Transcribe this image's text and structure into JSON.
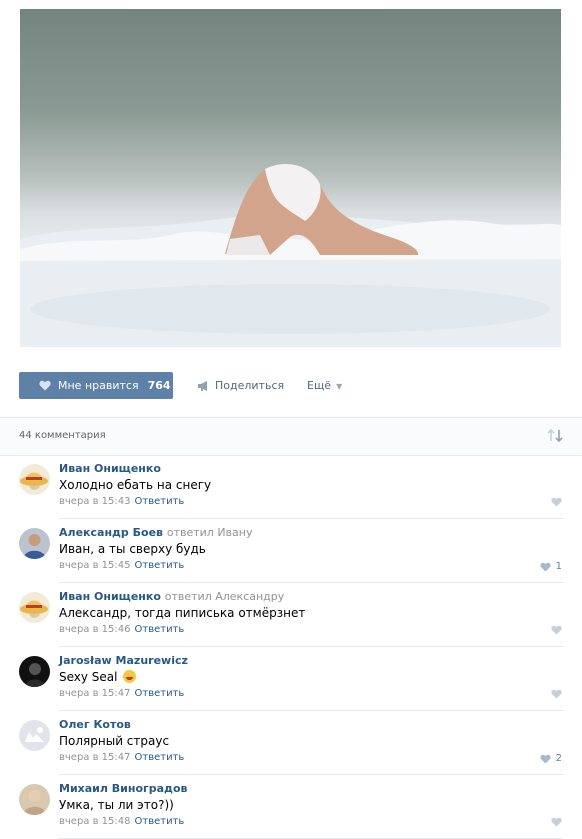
{
  "post": {
    "like_label": "Мне нравится",
    "like_count": "764",
    "share_label": "Поделиться",
    "more_label": "Ещё"
  },
  "comments_header": {
    "count_label": "44 комментария"
  },
  "comments": [
    {
      "author": "Иван Онищенко",
      "replied": "",
      "text": "Холодно ебать на снегу",
      "time": "вчера в 15:43",
      "reply_label": "Ответить",
      "likes": ""
    },
    {
      "author": "Александр Боев",
      "replied": "ответил Ивану",
      "text": "Иван, а ты сверху будь",
      "time": "вчера в 15:45",
      "reply_label": "Ответить",
      "likes": "1"
    },
    {
      "author": "Иван Онищенко",
      "replied": "ответил Александру",
      "text": "Александр, тогда пиписька отмёрзнет",
      "time": "вчера в 15:46",
      "reply_label": "Ответить",
      "likes": ""
    },
    {
      "author": "Jarosław Mazurewicz",
      "replied": "",
      "text": "Sexy Seal",
      "time": "вчера в 15:47",
      "reply_label": "Ответить",
      "likes": ""
    },
    {
      "author": "Олег Котов",
      "replied": "",
      "text": "Полярный страус",
      "time": "вчера в 15:47",
      "reply_label": "Ответить",
      "likes": "2"
    },
    {
      "author": "Михаил Виноградов",
      "replied": "",
      "text": "Умка, ты ли это?))",
      "time": "вчера в 15:48",
      "reply_label": "Ответить",
      "likes": ""
    }
  ],
  "colors": {
    "accent": "#5e81a8",
    "link": "#2a5885",
    "muted": "#939393"
  }
}
